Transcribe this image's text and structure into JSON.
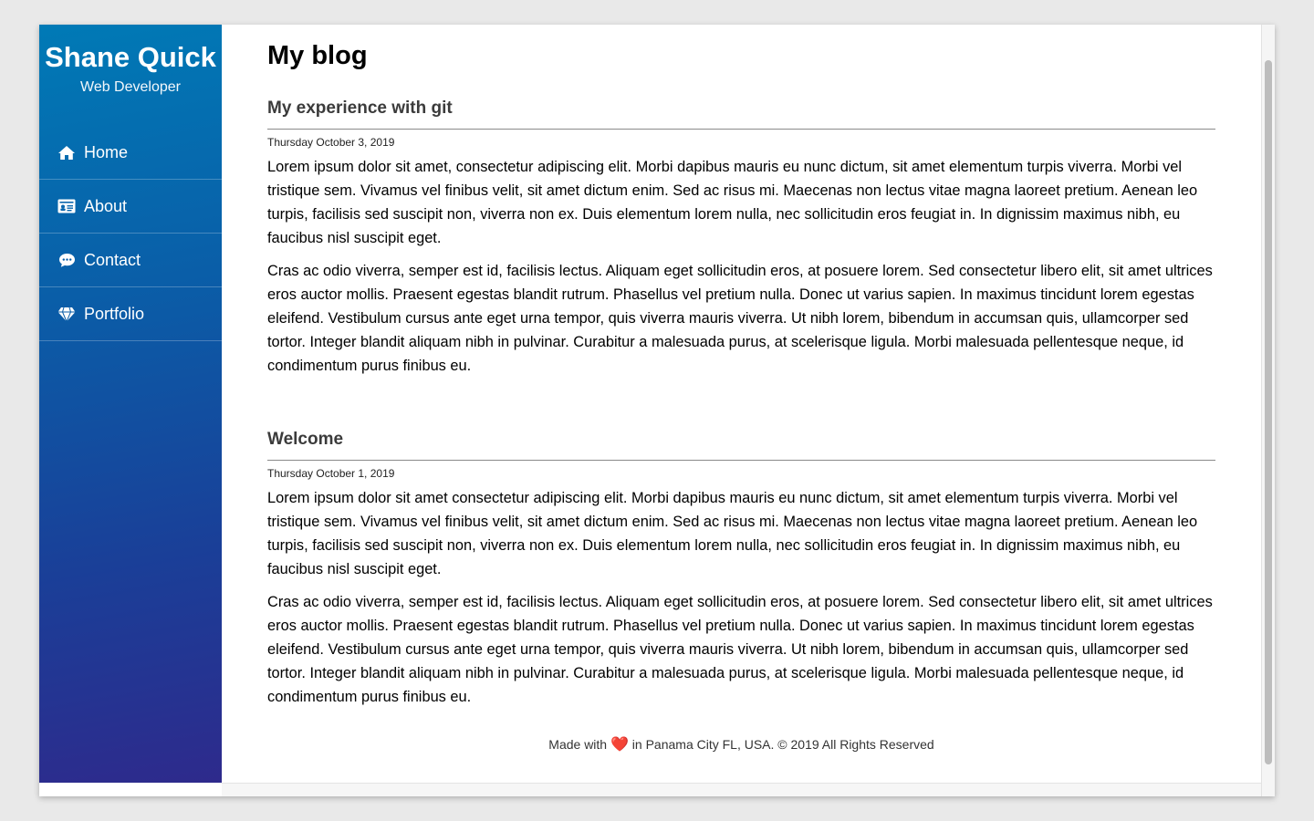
{
  "sidebar": {
    "brand_name": "Shane Quick",
    "brand_role": "Web Developer",
    "items": [
      {
        "label": "Home",
        "icon": "home-icon"
      },
      {
        "label": "About",
        "icon": "id-card-icon"
      },
      {
        "label": "Contact",
        "icon": "chat-bubble-icon"
      },
      {
        "label": "Portfolio",
        "icon": "diamond-icon"
      }
    ]
  },
  "main": {
    "title": "My blog",
    "posts": [
      {
        "title": "My experience with git",
        "date": "Thursday October 3, 2019",
        "paragraphs": [
          "Lorem ipsum dolor sit amet, consectetur adipiscing elit. Morbi dapibus mauris eu nunc dictum, sit amet elementum turpis viverra. Morbi vel tristique sem. Vivamus vel finibus velit, sit amet dictum enim. Sed ac risus mi. Maecenas non lectus vitae magna laoreet pretium. Aenean leo turpis, facilisis sed suscipit non, viverra non ex. Duis elementum lorem nulla, nec sollicitudin eros feugiat in. In dignissim maximus nibh, eu faucibus nisl suscipit eget.",
          "Cras ac odio viverra, semper est id, facilisis lectus. Aliquam eget sollicitudin eros, at posuere lorem. Sed consectetur libero elit, sit amet ultrices eros auctor mollis. Praesent egestas blandit rutrum. Phasellus vel pretium nulla. Donec ut varius sapien. In maximus tincidunt lorem egestas eleifend. Vestibulum cursus ante eget urna tempor, quis viverra mauris viverra. Ut nibh lorem, bibendum in accumsan quis, ullamcorper sed tortor. Integer blandit aliquam nibh in pulvinar. Curabitur a malesuada purus, at scelerisque ligula. Morbi malesuada pellentesque neque, id condimentum purus finibus eu."
        ]
      },
      {
        "title": "Welcome",
        "date": "Thursday October 1, 2019",
        "paragraphs": [
          "Lorem ipsum dolor sit amet consectetur adipiscing elit. Morbi dapibus mauris eu nunc dictum, sit amet elementum turpis viverra. Morbi vel tristique sem. Vivamus vel finibus velit, sit amet dictum enim. Sed ac risus mi. Maecenas non lectus vitae magna laoreet pretium. Aenean leo turpis, facilisis sed suscipit non, viverra non ex. Duis elementum lorem nulla, nec sollicitudin eros feugiat in. In dignissim maximus nibh, eu faucibus nisl suscipit eget.",
          "Cras ac odio viverra, semper est id, facilisis lectus. Aliquam eget sollicitudin eros, at posuere lorem. Sed consectetur libero elit, sit amet ultrices eros auctor mollis. Praesent egestas blandit rutrum. Phasellus vel pretium nulla. Donec ut varius sapien. In maximus tincidunt lorem egestas eleifend. Vestibulum cursus ante eget urna tempor, quis viverra mauris viverra. Ut nibh lorem, bibendum in accumsan quis, ullamcorper sed tortor. Integer blandit aliquam nibh in pulvinar. Curabitur a malesuada purus, at scelerisque ligula. Morbi malesuada pellentesque neque, id condimentum purus finibus eu."
        ]
      }
    ]
  },
  "footer": {
    "made_with": "Made with",
    "heart": "❤️",
    "rest": "in Panama City FL, USA. © 2019 All Rights Reserved"
  },
  "colors": {
    "sidebar_top": "#007ab6",
    "sidebar_bottom": "#2e2a8c",
    "heart": "#e02020"
  }
}
